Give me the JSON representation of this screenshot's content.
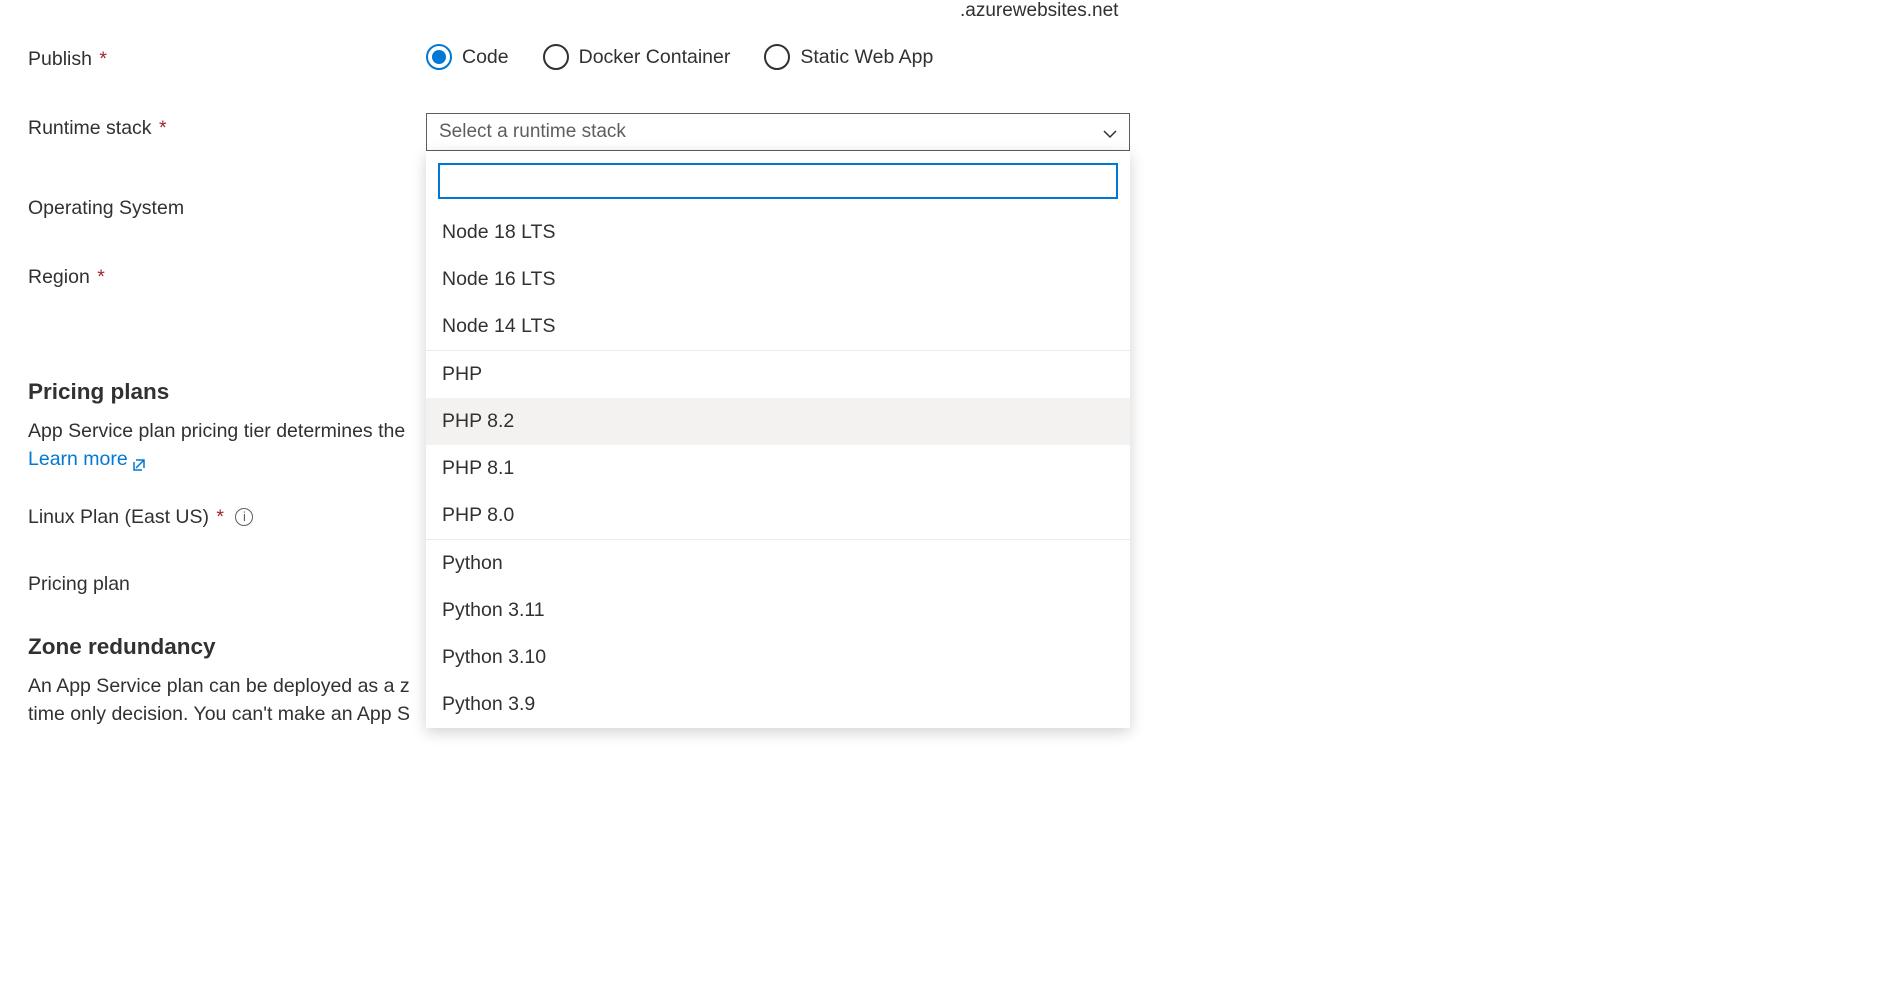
{
  "suffix": ".azurewebsites.net",
  "labels": {
    "publish": "Publish",
    "runtime_stack": "Runtime stack",
    "operating_system": "Operating System",
    "region": "Region",
    "linux_plan": "Linux Plan (East US)",
    "pricing_plan": "Pricing plan"
  },
  "publish_options": {
    "code": "Code",
    "docker": "Docker Container",
    "static": "Static Web App"
  },
  "runtime_select": {
    "placeholder": "Select a runtime stack"
  },
  "dropdown": {
    "search_value": "",
    "items": [
      {
        "type": "item",
        "label": "Node 18 LTS"
      },
      {
        "type": "item",
        "label": "Node 16 LTS"
      },
      {
        "type": "item",
        "label": "Node 14 LTS"
      },
      {
        "type": "group",
        "label": "PHP"
      },
      {
        "type": "item",
        "label": "PHP 8.2",
        "hovered": true
      },
      {
        "type": "item",
        "label": "PHP 8.1"
      },
      {
        "type": "item",
        "label": "PHP 8.0"
      },
      {
        "type": "group",
        "label": "Python"
      },
      {
        "type": "item",
        "label": "Python 3.11"
      },
      {
        "type": "item",
        "label": "Python 3.10"
      },
      {
        "type": "item",
        "label": "Python 3.9"
      }
    ]
  },
  "pricing": {
    "heading": "Pricing plans",
    "description_part": "App Service plan pricing tier determines the",
    "learn_more": "Learn more"
  },
  "zone": {
    "heading": "Zone redundancy",
    "description_line1": "An App Service plan can be deployed as a z",
    "description_line2": "time only decision. You can't make an App S"
  }
}
